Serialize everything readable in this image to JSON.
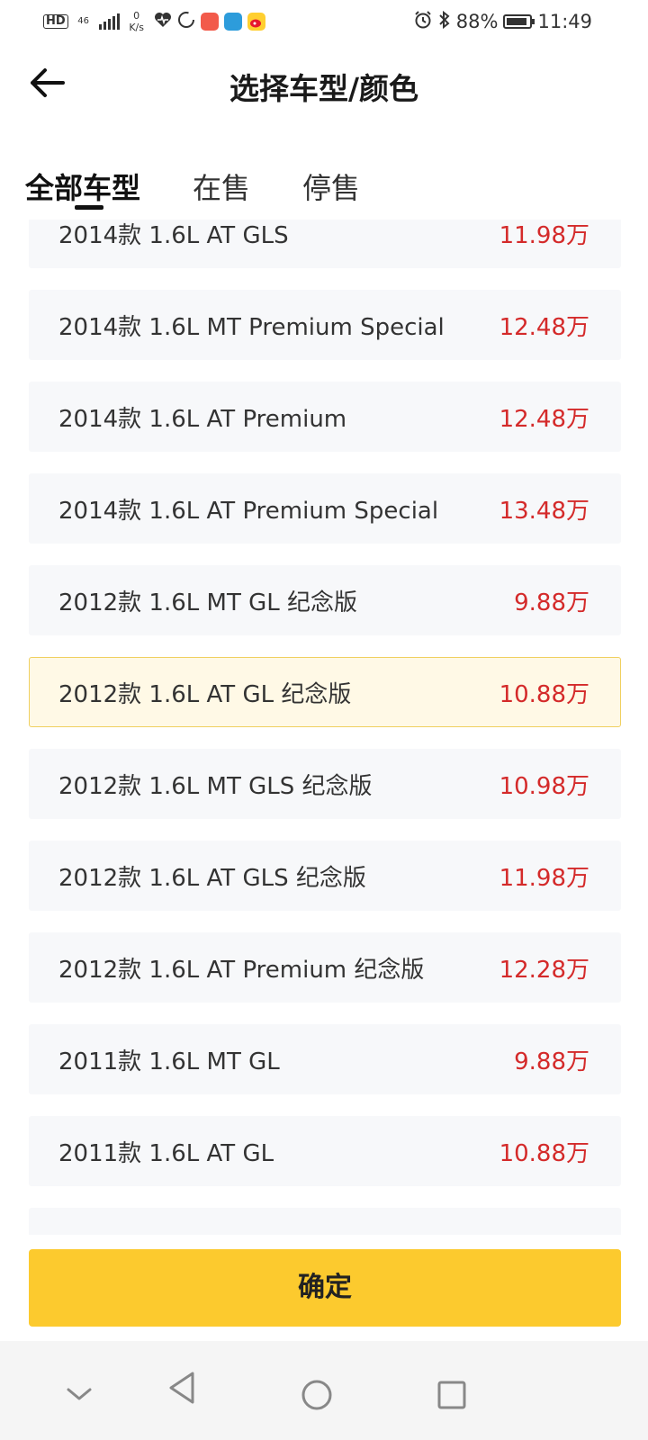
{
  "status_bar": {
    "hd": "HD",
    "network": "46",
    "speed_value": "0",
    "speed_unit": "K/s",
    "battery": "88%",
    "time": "11:49"
  },
  "header": {
    "title": "选择车型/颜色"
  },
  "tabs": [
    {
      "label": "全部车型",
      "active": true
    },
    {
      "label": "在售",
      "active": false
    },
    {
      "label": "停售",
      "active": false
    }
  ],
  "models": [
    {
      "name": "2014款 1.6L AT GLS",
      "price": "11.98万"
    },
    {
      "name": "2014款 1.6L MT Premium Special",
      "price": "12.48万"
    },
    {
      "name": "2014款 1.6L AT Premium",
      "price": "12.48万"
    },
    {
      "name": "2014款 1.6L AT Premium Special",
      "price": "13.48万"
    },
    {
      "name": "2012款 1.6L MT GL 纪念版",
      "price": "9.88万"
    },
    {
      "name": "2012款 1.6L AT GL 纪念版",
      "price": "10.88万",
      "selected": true
    },
    {
      "name": "2012款 1.6L MT GLS 纪念版",
      "price": "10.98万"
    },
    {
      "name": "2012款 1.6L AT GLS 纪念版",
      "price": "11.98万"
    },
    {
      "name": "2012款 1.6L AT Premium 纪念版",
      "price": "12.28万"
    },
    {
      "name": "2011款 1.6L MT GL",
      "price": "9.88万"
    },
    {
      "name": "2011款 1.6L AT GL",
      "price": "10.88万"
    }
  ],
  "confirm_label": "确定",
  "colors": {
    "accent": "#fcca2e",
    "price": "#d42a2a",
    "selected_bg": "#fff9e6",
    "selected_border": "#f0d060"
  },
  "icons": {
    "back": "arrow-left-icon",
    "nav_down": "chevron-down-icon",
    "nav_back": "triangle-back-icon",
    "nav_home": "circle-home-icon",
    "nav_recent": "square-recent-icon"
  }
}
